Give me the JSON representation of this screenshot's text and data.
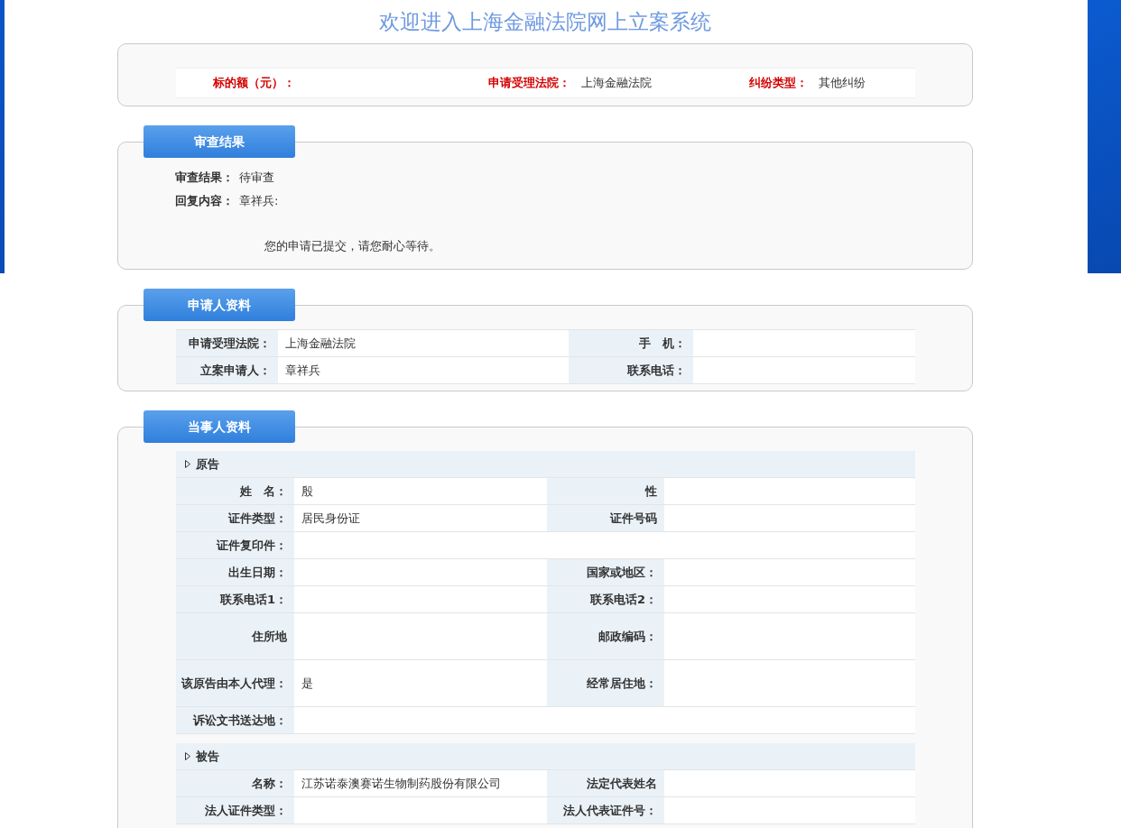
{
  "title": "欢迎进入上海金融法院网上立案系统",
  "summary": [
    {
      "label": "标的额（元）："
    },
    {
      "label": "申请受理法院：",
      "value": "上海金融法院"
    },
    {
      "label": "纠纷类型：",
      "value": "其他纠纷"
    }
  ],
  "review": {
    "tab": "审查结果",
    "fields": [
      {
        "label": "审查结果：",
        "value": "待审查"
      },
      {
        "label": "回复内容：",
        "value": "章祥兵:"
      }
    ],
    "message": "您的申请已提交，请您耐心等待。"
  },
  "applicant": {
    "tab": "申请人资料",
    "rows": [
      [
        {
          "label": "申请受理法院：",
          "value": "上海金融法院"
        },
        {
          "label": "手　机："
        }
      ],
      [
        {
          "label": "立案申请人：",
          "value": "章祥兵"
        },
        {
          "label": "联系电话："
        }
      ]
    ]
  },
  "parties": {
    "tab": "当事人资料",
    "groups": [
      {
        "title": "原告",
        "rows": [
          {
            "kind": "pair",
            "cells": [
              {
                "label": "姓　名：",
                "value": "殷"
              },
              {
                "label": "性"
              }
            ]
          },
          {
            "kind": "pair",
            "cells": [
              {
                "label": "证件类型：",
                "value": "居民身份证"
              },
              {
                "label": "证件号码"
              }
            ]
          },
          {
            "kind": "full",
            "cells": [
              {
                "label": "证件复印件："
              }
            ]
          },
          {
            "kind": "pair",
            "cells": [
              {
                "label": "出生日期："
              },
              {
                "label": "国家或地区："
              }
            ]
          },
          {
            "kind": "pair",
            "cells": [
              {
                "label": "联系电话1："
              },
              {
                "label": "联系电话2："
              }
            ]
          },
          {
            "kind": "tall",
            "cells": [
              {
                "label": "住所地"
              },
              {
                "label": "邮政编码："
              }
            ]
          },
          {
            "kind": "tall",
            "cells": [
              {
                "label": "该原告由本人代理：",
                "value": "是"
              },
              {
                "label": "经常居住地："
              }
            ]
          },
          {
            "kind": "full",
            "cells": [
              {
                "label": "诉讼文书送达地："
              }
            ]
          }
        ]
      },
      {
        "title": "被告",
        "rows": [
          {
            "kind": "pair",
            "cells": [
              {
                "label": "名称：",
                "value": "江苏诺泰澳赛诺生物制药股份有限公司"
              },
              {
                "label": "法定代表姓名"
              }
            ]
          },
          {
            "kind": "pair",
            "cells": [
              {
                "label": "法人证件类型："
              },
              {
                "label": "法人代表证件号："
              }
            ]
          }
        ]
      }
    ]
  }
}
